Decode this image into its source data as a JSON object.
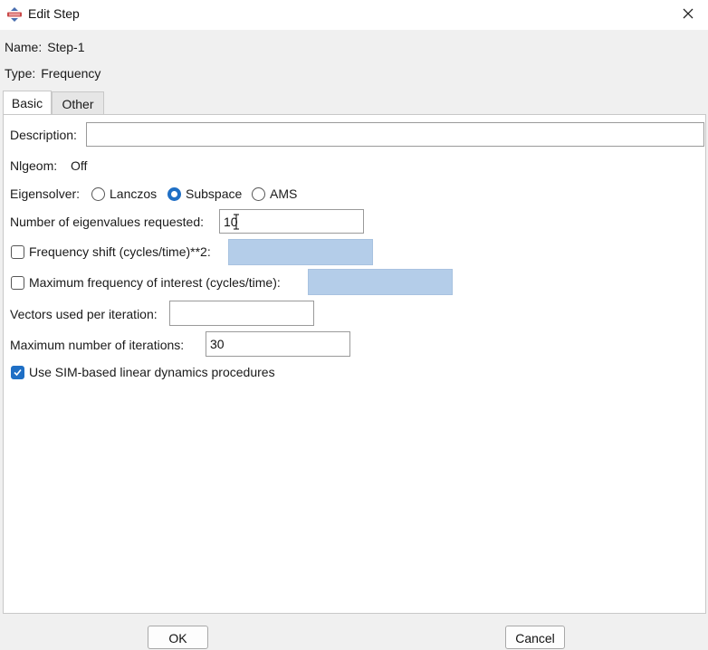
{
  "window": {
    "title": "Edit Step",
    "icon": "step-gear-icon",
    "close_icon": "close-icon"
  },
  "step": {
    "name_label": "Name:",
    "name_value": "Step-1",
    "type_label": "Type:",
    "type_value": "Frequency"
  },
  "tabs": [
    {
      "label": "Basic",
      "selected": true
    },
    {
      "label": "Other",
      "selected": false
    }
  ],
  "form": {
    "description_label": "Description:",
    "description_value": "",
    "nlgeom_label": "Nlgeom:",
    "nlgeom_value": "Off",
    "eigensolver_label": "Eigensolver:",
    "eigensolver_options": [
      "Lanczos",
      "Subspace",
      "AMS"
    ],
    "eigensolver_selected": "Subspace",
    "num_eigenvalues_label": "Number of eigenvalues requested:",
    "num_eigenvalues_value": "10",
    "freq_shift_label": "Frequency shift (cycles/time)**2:",
    "freq_shift_checked": false,
    "max_freq_label": "Maximum frequency of interest (cycles/time):",
    "max_freq_checked": false,
    "vectors_label": "Vectors used per iteration:",
    "vectors_value": "",
    "max_iterations_label": "Maximum number of iterations:",
    "max_iterations_value": "30",
    "sim_label": "Use SIM-based linear dynamics procedures",
    "sim_checked": true
  },
  "buttons": {
    "ok": "OK",
    "cancel": "Cancel"
  },
  "colors": {
    "accent": "#1f6fc5",
    "disabled_field": "#b4cde9",
    "panel_bg": "#ffffff",
    "window_bg": "#f0f0f0"
  }
}
